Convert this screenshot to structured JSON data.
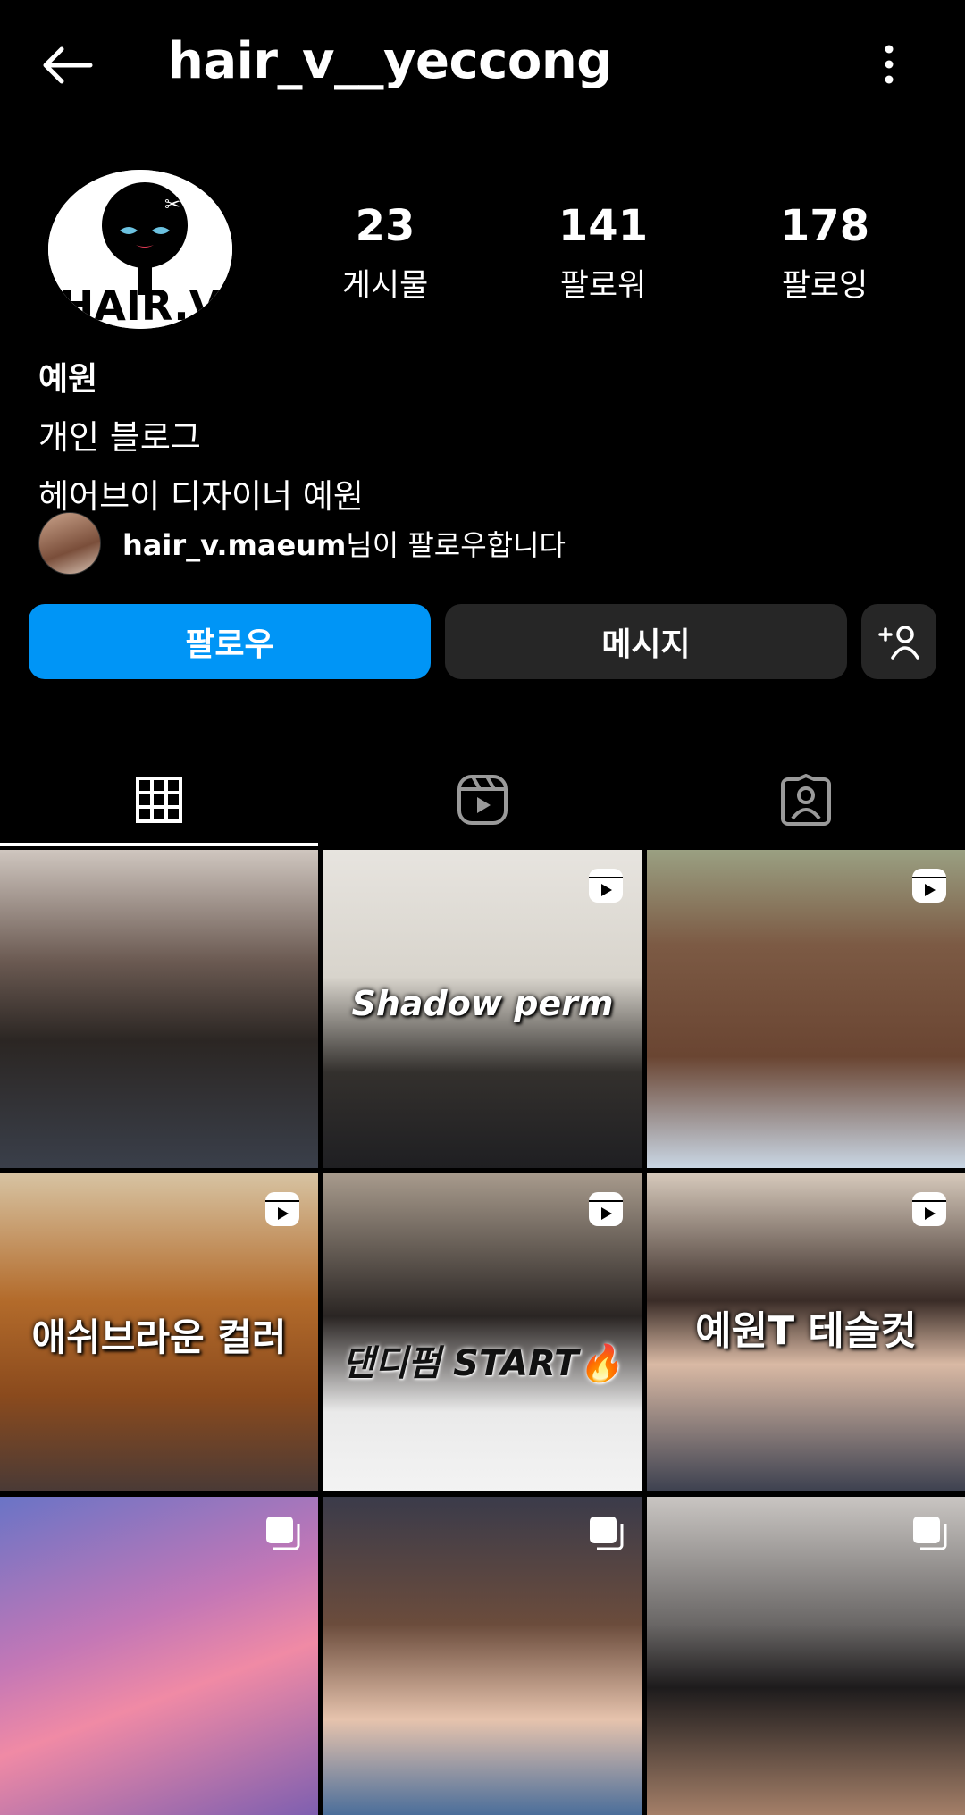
{
  "header": {
    "username": "hair_v__yeccong",
    "back_icon": "back-arrow-icon",
    "more_icon": "more-vertical-icon"
  },
  "profile": {
    "avatar_text": "HAIR.V",
    "stats": [
      {
        "value": "23",
        "label": "게시물"
      },
      {
        "value": "141",
        "label": "팔로워"
      },
      {
        "value": "178",
        "label": "팔로잉"
      }
    ],
    "name": "예원",
    "bio_lines": [
      "개인 블로그",
      "헤어브이 디자이너 예원"
    ],
    "followed_by_user": "hair_v.maeum",
    "followed_by_suffix": "님이 팔로우합니다"
  },
  "actions": {
    "follow_label": "팔로우",
    "message_label": "메시지",
    "follow_color": "#0095f6"
  },
  "tabs": [
    {
      "name": "posts",
      "icon": "grid-icon",
      "selected": true
    },
    {
      "name": "reels",
      "icon": "reels-icon",
      "selected": false
    },
    {
      "name": "tagged",
      "icon": "tagged-person-icon",
      "selected": false
    }
  ],
  "grid": [
    {
      "overlay": "",
      "icon": ""
    },
    {
      "overlay": "Shadow perm",
      "icon": "reel-icon"
    },
    {
      "overlay": "",
      "icon": "reel-icon"
    },
    {
      "overlay": "애쉬브라운 컬러",
      "icon": "reel-icon"
    },
    {
      "overlay": "댄디펌 START🔥",
      "icon": "reel-icon"
    },
    {
      "overlay": "예원T 테슬컷",
      "icon": "reel-icon"
    },
    {
      "overlay": "",
      "icon": "carousel-icon"
    },
    {
      "overlay": "",
      "icon": "carousel-icon"
    },
    {
      "overlay": "",
      "icon": "carousel-icon"
    }
  ]
}
